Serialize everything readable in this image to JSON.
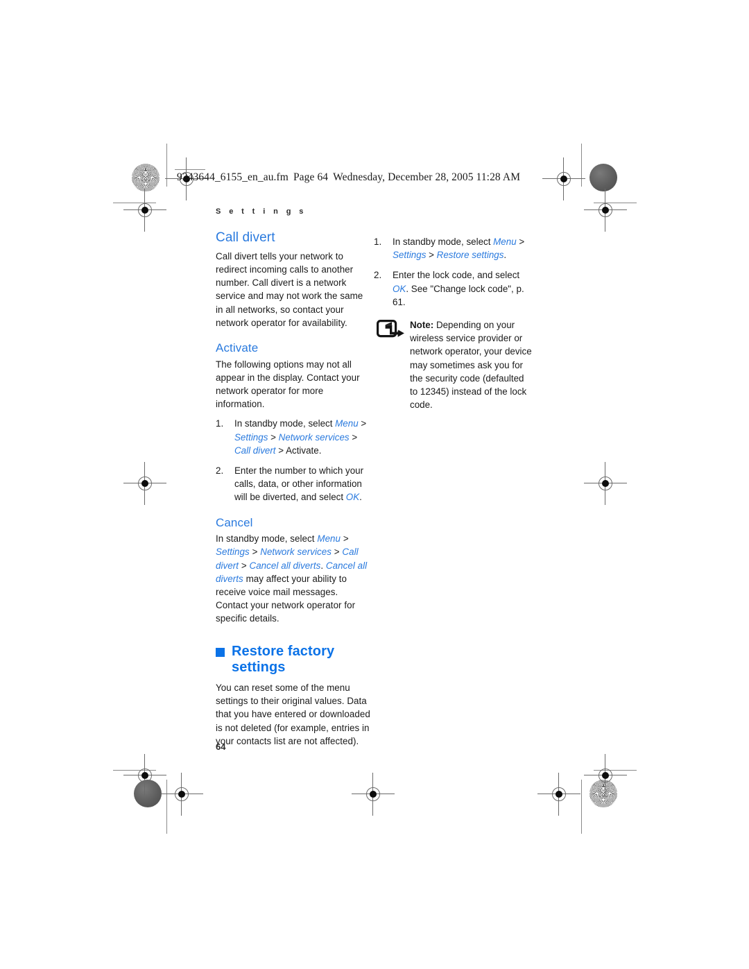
{
  "document": {
    "fm_header": {
      "filename": "9243644_6155_en_au.fm",
      "page_label": "Page 64",
      "timestamp": "Wednesday, December 28, 2005  11:28 AM"
    },
    "running_head": "S e t t i n g s",
    "page_number": "64",
    "colors": {
      "heading_blue": "#2a7ade",
      "chapter_blue": "#0b72e7",
      "body_text": "#1a1a1a"
    }
  },
  "left_column": {
    "section_heading": "Call divert",
    "intro_paragraph": "Call divert tells your network to redirect incoming calls to another number. Call divert is a network service and may not work the same in all networks, so contact your network operator for availability.",
    "activate": {
      "heading": "Activate",
      "paragraph": "The following options may not all appear in the display. Contact your network operator for more information.",
      "steps": [
        {
          "number": "1.",
          "prefix": "In standby mode, select ",
          "path_1": "Menu",
          "sep_1": " > ",
          "path_2": "Settings",
          "sep_2": " > ",
          "path_3": "Network services",
          "sep_3": " > ",
          "path_4": "Call divert",
          "suffix": " > Activate."
        },
        {
          "number": "2.",
          "prefix": "Enter the number to which your calls, data, or other information will be diverted, and select ",
          "path_1": "OK",
          "suffix": "."
        }
      ]
    },
    "cancel": {
      "heading": "Cancel",
      "prefix": "In standby mode, select ",
      "path_1": "Menu",
      "sep_1": " > ",
      "path_2": "Settings",
      "sep_2": " > ",
      "path_3": "Network services",
      "sep_3": " > ",
      "path_4": "Call divert",
      "sep_4": " > ",
      "path_5": "Cancel all diverts",
      "sep_5": ". ",
      "path_6": "Cancel all diverts",
      "suffix": " may affect your ability to receive voice mail messages. Contact your network operator for specific details."
    },
    "chapter": {
      "heading": "Restore factory settings",
      "paragraph": "You can reset some of the menu settings to their original values. Data that you have entered or downloaded is not deleted (for example, entries in your contacts list are not affected)."
    }
  },
  "right_column": {
    "steps": [
      {
        "number": "1.",
        "prefix": "In standby mode, select ",
        "path_1": "Menu",
        "sep_1": " > ",
        "path_2": "Settings",
        "sep_2": " > ",
        "path_3": "Restore settings",
        "suffix": "."
      },
      {
        "number": "2.",
        "prefix": "Enter the lock code, and select ",
        "path_1": "OK",
        "suffix": ". See \"Change lock code\", p. 61."
      }
    ],
    "note": {
      "label": "Note:",
      "text": " Depending on your wireless service provider or network operator, your device may sometimes ask you for the security code (defaulted to 12345) instead of the lock code.",
      "icon": "note-pointer-icon"
    }
  }
}
